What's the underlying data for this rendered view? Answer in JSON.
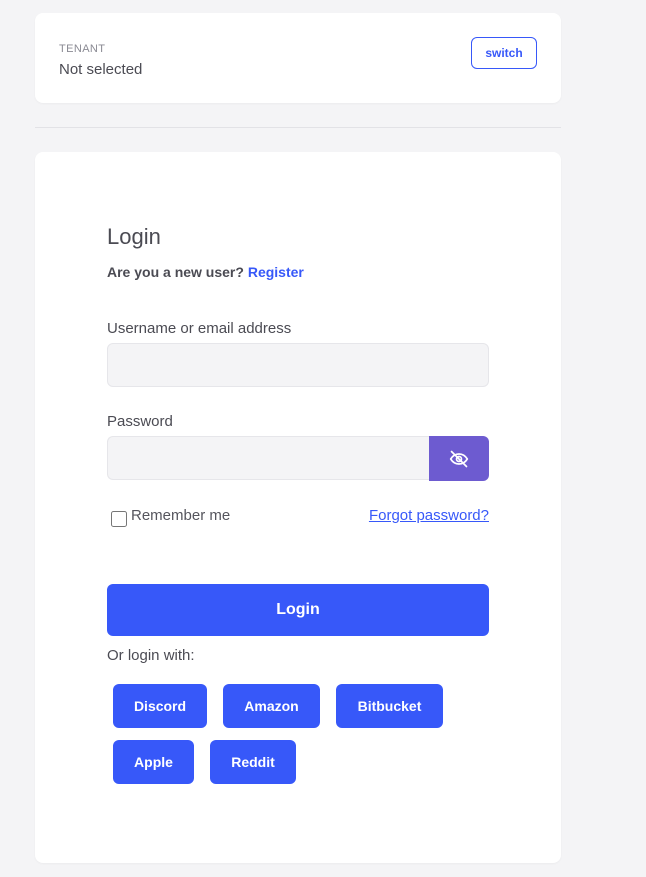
{
  "tenant": {
    "label": "TENANT",
    "value": "Not selected",
    "switch_label": "switch"
  },
  "login": {
    "title": "Login",
    "new_user_prompt": "Are you a new user?",
    "register_link": "Register",
    "username_label": "Username or email address",
    "username_value": "",
    "password_label": "Password",
    "password_value": "",
    "remember_label": "Remember me",
    "remember_checked": false,
    "forgot_link": "Forgot password?",
    "submit_label": "Login",
    "social_heading": "Or login with:",
    "social_providers": [
      "Discord",
      "Amazon",
      "Bitbucket",
      "Apple",
      "Reddit"
    ]
  },
  "icons": {
    "password_toggle": "eye-off-icon"
  },
  "colors": {
    "primary": "#3758f9",
    "toggle_button": "#6d5bd0",
    "background": "#f4f4f6",
    "card": "#ffffff"
  }
}
